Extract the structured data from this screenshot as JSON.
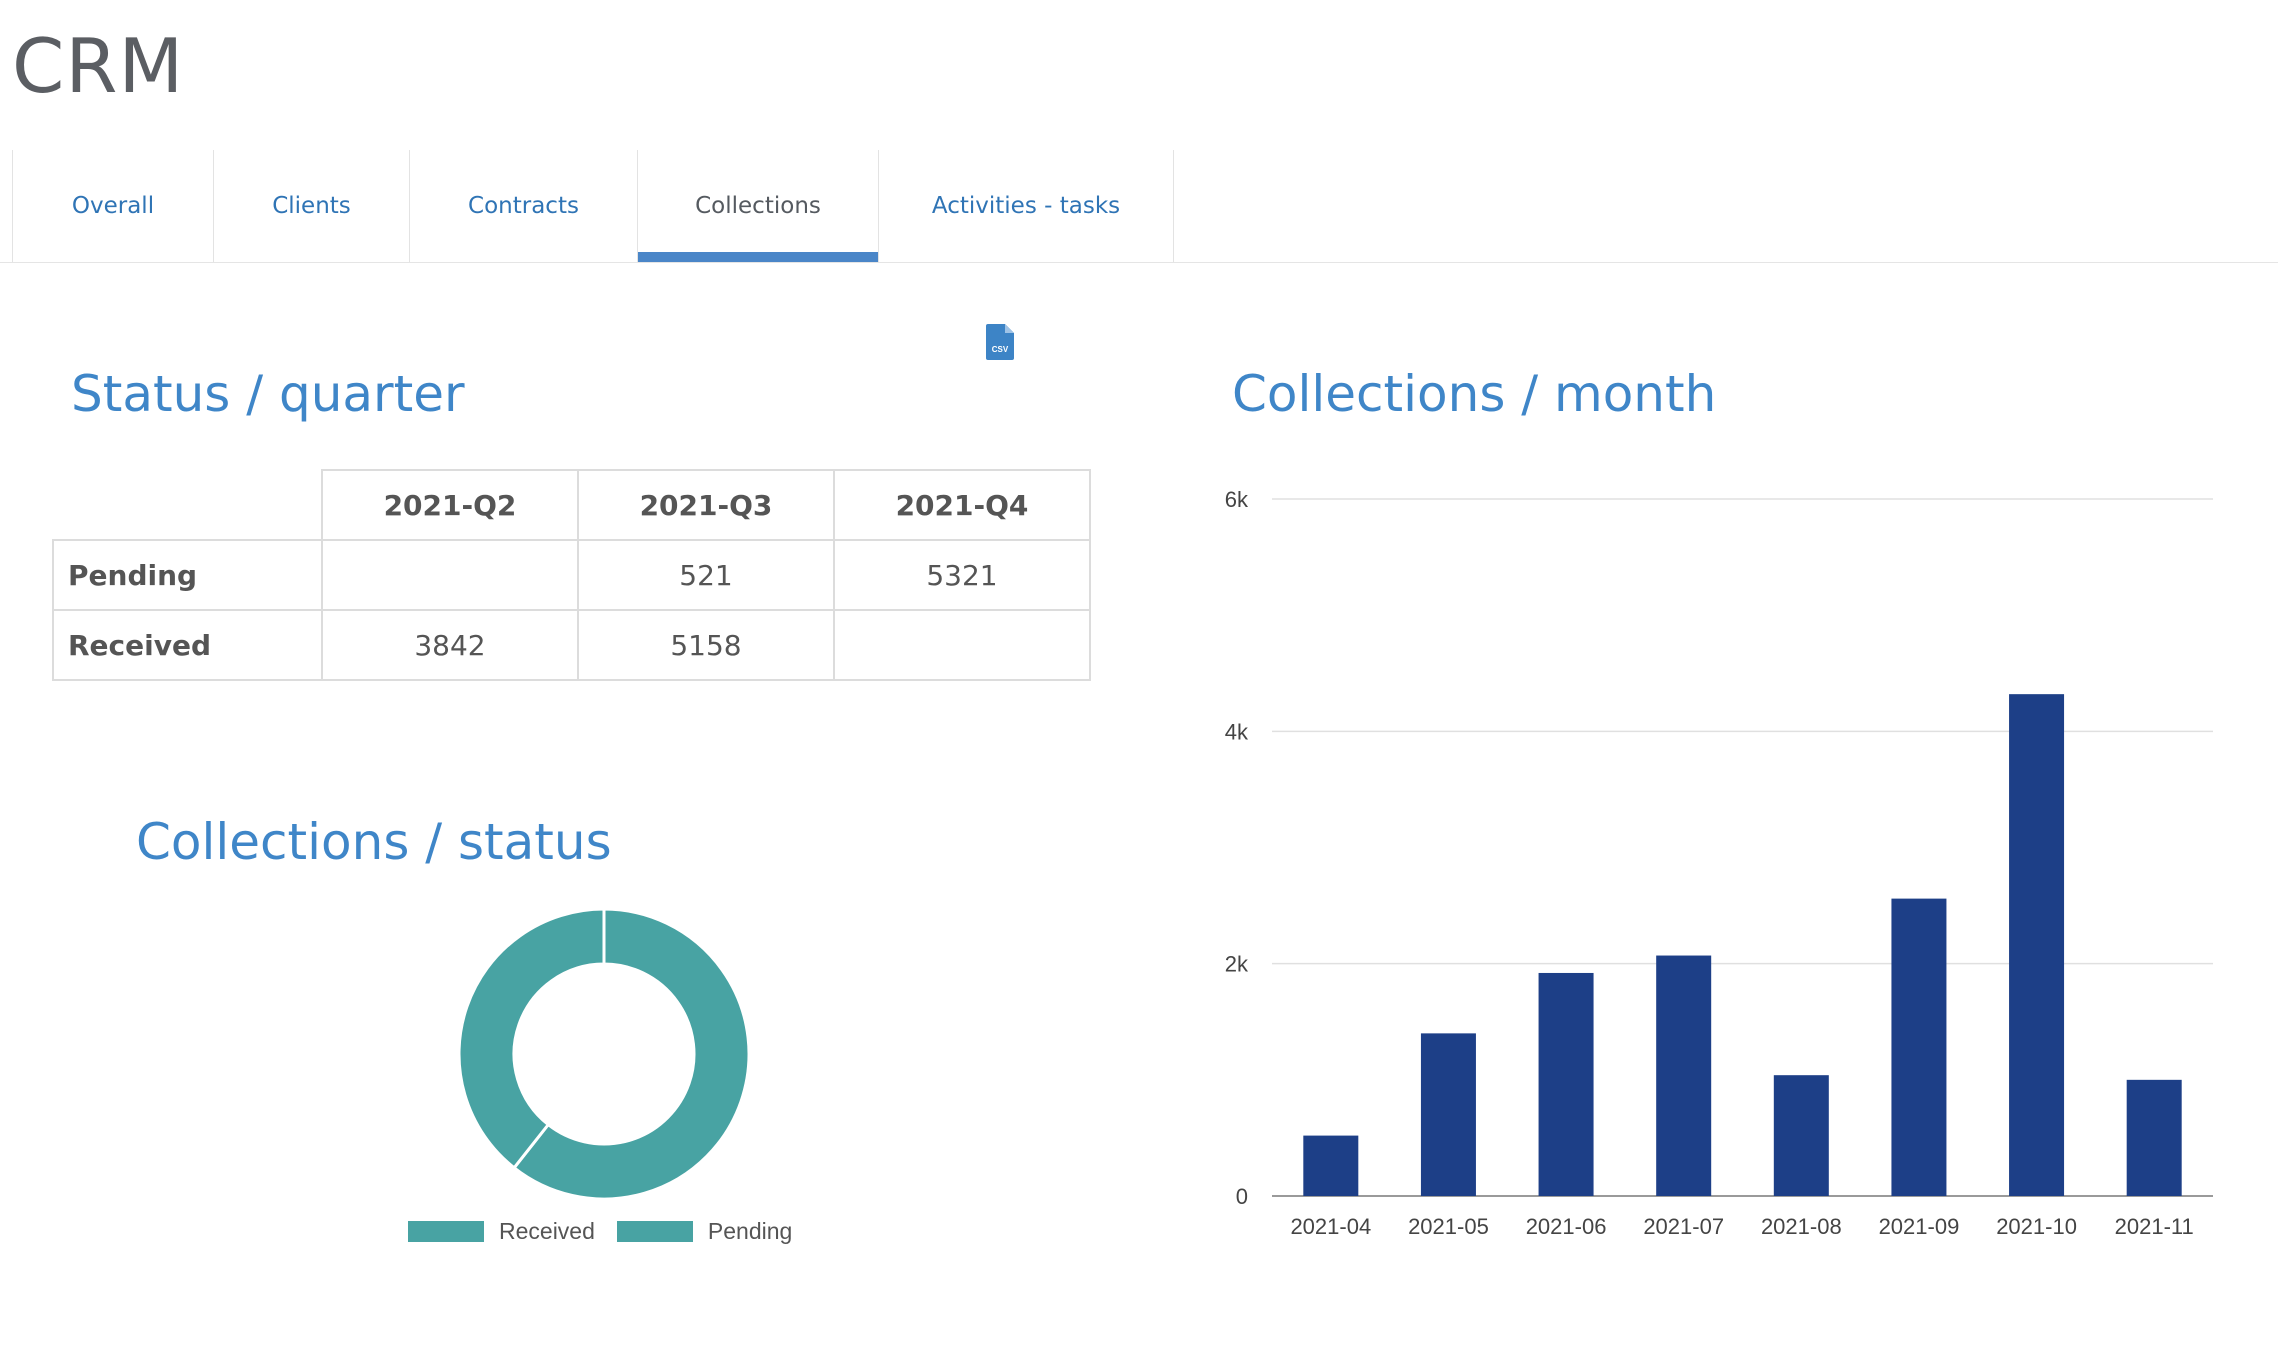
{
  "app": {
    "title": "CRM"
  },
  "tabs": [
    {
      "label": "Overall",
      "active": false
    },
    {
      "label": "Clients",
      "active": false
    },
    {
      "label": "Contracts",
      "active": false
    },
    {
      "label": "Collections",
      "active": true
    },
    {
      "label": "Activities - tasks",
      "active": false
    }
  ],
  "export": {
    "icon": "csv-file-icon",
    "label": "CSV"
  },
  "status_quarter": {
    "title": "Status / quarter",
    "columns": [
      "2021-Q2",
      "2021-Q3",
      "2021-Q4"
    ],
    "rows": [
      {
        "label": "Pending",
        "values": [
          "",
          "521",
          "5321"
        ]
      },
      {
        "label": "Received",
        "values": [
          "3842",
          "5158",
          ""
        ]
      }
    ]
  },
  "collections_status": {
    "title": "Collections / status",
    "colors": {
      "received": "#48a3a3",
      "pending": "#48a3a3"
    },
    "legend": [
      "Received",
      "Pending"
    ]
  },
  "collections_month": {
    "title": "Collections / month",
    "bar_color": "#1d3f87"
  },
  "chart_data": [
    {
      "type": "pie",
      "title": "Collections / status",
      "variant": "donut",
      "labels": [
        "Received",
        "Pending"
      ],
      "values": [
        9000,
        5842
      ],
      "colors": [
        "#48a3a3",
        "#48a3a3"
      ],
      "legend": "bottom"
    },
    {
      "type": "bar",
      "title": "Collections / month",
      "categories": [
        "2021-04",
        "2021-05",
        "2021-06",
        "2021-07",
        "2021-08",
        "2021-09",
        "2021-10",
        "2021-11"
      ],
      "values": [
        520,
        1400,
        1920,
        2070,
        1040,
        2560,
        4320,
        1000
      ],
      "ylim": [
        0,
        6000
      ],
      "yticks": [
        "0",
        "2k",
        "4k",
        "6k"
      ],
      "ytick_values": [
        0,
        2000,
        4000,
        6000
      ],
      "grid": true,
      "color": "#1d3f87"
    }
  ]
}
